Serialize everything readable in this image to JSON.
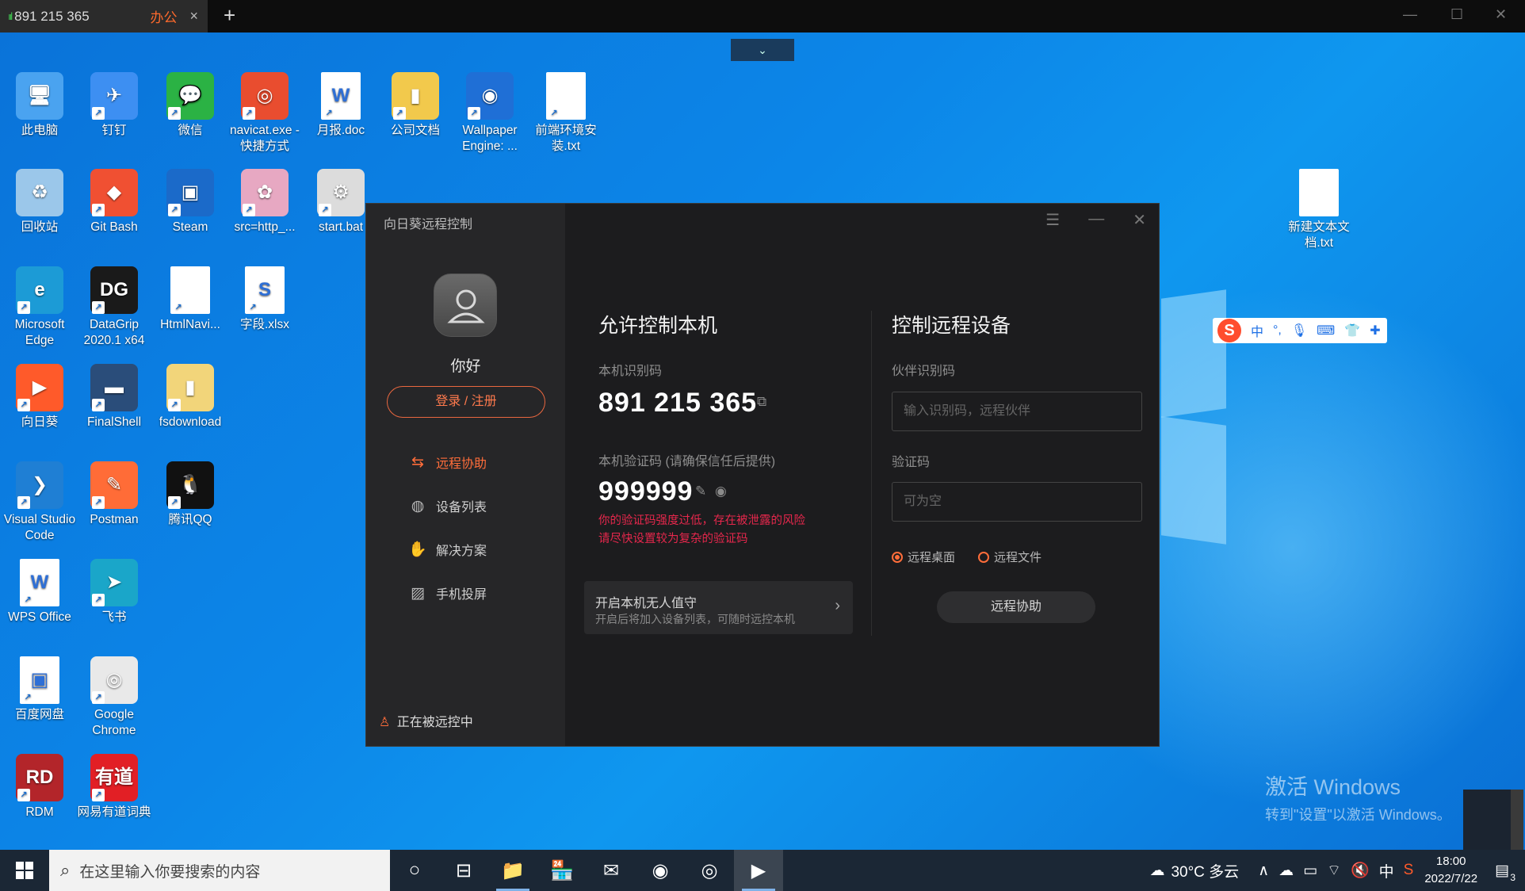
{
  "session": {
    "signal": "ııl",
    "id": "891 215 365",
    "tag": "办公",
    "close": "×",
    "new_tab": "+",
    "collapse": "⌄",
    "controls": [
      "—",
      "☐",
      "✕"
    ]
  },
  "desktop_icons": [
    {
      "label": "此电脑",
      "color": "#4aa3f0",
      "glyph": "🖥"
    },
    {
      "label": "钉钉",
      "color": "#3d8ff2",
      "glyph": "✈"
    },
    {
      "label": "微信",
      "color": "#2bb244",
      "glyph": "💬"
    },
    {
      "label": "navicat.exe - 快捷方式",
      "color": "#e94d2f",
      "glyph": "◎"
    },
    {
      "label": "月报.doc",
      "color": "#ffffff",
      "glyph": "W"
    },
    {
      "label": "公司文档",
      "color": "#f2c94c",
      "glyph": "▮"
    },
    {
      "label": "Wallpaper Engine: ...",
      "color": "#1f6fd6",
      "glyph": "◉"
    },
    {
      "label": "前端环境安装.txt",
      "color": "#ffffff",
      "glyph": ""
    },
    {
      "label": "回收站",
      "color": "#9bc7ea",
      "glyph": "♻"
    },
    {
      "label": "Git Bash",
      "color": "#f05032",
      "glyph": "◆"
    },
    {
      "label": "Steam",
      "color": "#1b6ac9",
      "glyph": "▣"
    },
    {
      "label": "src=http_...",
      "color": "#e7a8c2",
      "glyph": "✿"
    },
    {
      "label": "start.bat",
      "color": "#dcdcdc",
      "glyph": "⚙"
    },
    {
      "label": "Microsoft Edge",
      "color": "#1c9bd6",
      "glyph": "e"
    },
    {
      "label": "DataGrip 2020.1 x64",
      "color": "#1a1a1a",
      "glyph": "DG"
    },
    {
      "label": "HtmlNavi...",
      "color": "#ffffff",
      "glyph": ""
    },
    {
      "label": "字段.xlsx",
      "color": "#ffffff",
      "glyph": "S"
    },
    {
      "label": "向日葵",
      "color": "#ff5a2a",
      "glyph": "▶"
    },
    {
      "label": "FinalShell",
      "color": "#2a4d7a",
      "glyph": "▬"
    },
    {
      "label": "fsdownload",
      "color": "#f2d57a",
      "glyph": "▮"
    },
    {
      "label": "Visual Studio Code",
      "color": "#1f7fd4",
      "glyph": "❯"
    },
    {
      "label": "Postman",
      "color": "#ff6c37",
      "glyph": "✎"
    },
    {
      "label": "腾讯QQ",
      "color": "#111111",
      "glyph": "🐧"
    },
    {
      "label": "WPS Office",
      "color": "#ffffff",
      "glyph": "W"
    },
    {
      "label": "飞书",
      "color": "#1aa6c9",
      "glyph": "➤"
    },
    {
      "label": "百度网盘",
      "color": "#ffffff",
      "glyph": "▣"
    },
    {
      "label": "Google Chrome",
      "color": "#e9e9e9",
      "glyph": "◎"
    },
    {
      "label": "RDM",
      "color": "#b3252a",
      "glyph": "RD"
    },
    {
      "label": "网易有道词典",
      "color": "#e21f25",
      "glyph": "有道"
    },
    {
      "label": "新建文本文档.txt",
      "color": "#ffffff",
      "glyph": ""
    }
  ],
  "ime": {
    "logo": "S",
    "items": [
      "中",
      "°,",
      "🎙",
      "⌨",
      "👕",
      "✚"
    ]
  },
  "watermark": {
    "line1": "激活 Windows",
    "line2": "转到\"设置\"以激活 Windows。"
  },
  "app": {
    "title": "向日葵远程控制",
    "greeting": "你好",
    "login": "登录 / 注册",
    "nav": [
      {
        "label": "远程协助",
        "icon": "⇆"
      },
      {
        "label": "设备列表",
        "icon": "◍"
      },
      {
        "label": "解决方案",
        "icon": "✋"
      },
      {
        "label": "手机投屏",
        "icon": "▨"
      }
    ],
    "status": "正在被远控中",
    "controls": [
      "☰",
      "—",
      "✕"
    ],
    "allow": {
      "heading": "允许控制本机",
      "id_label": "本机识别码",
      "id_value": "891 215 365",
      "code_label": "本机验证码 (请确保信任后提供)",
      "code_value": "999999",
      "warn_line1": "你的验证码强度过低，存在被泄露的风险",
      "warn_line2": "请尽快设置较为复杂的验证码",
      "unattended_title": "开启本机无人值守",
      "unattended_sub": "开启后将加入设备列表，可随时远控本机",
      "chevron": "›"
    },
    "control": {
      "heading": "控制远程设备",
      "partner_label": "伙伴识别码",
      "partner_placeholder": "输入识别码，远程伙伴",
      "code_label": "验证码",
      "code_placeholder": "可为空",
      "radio_desktop": "远程桌面",
      "radio_file": "远程文件",
      "connect": "远程协助"
    }
  },
  "taskbar": {
    "search_placeholder": "在这里输入你要搜索的内容",
    "apps": [
      "○",
      "⊟",
      "📁",
      "🏪",
      "✉",
      "◉",
      "◎",
      "▶"
    ],
    "weather": "30°C 多云",
    "tray": [
      "∧",
      "☁",
      "▭",
      "⌔",
      "🔇",
      "中",
      "S"
    ],
    "time": "18:00",
    "date": "2022/7/22",
    "notif": "3"
  }
}
